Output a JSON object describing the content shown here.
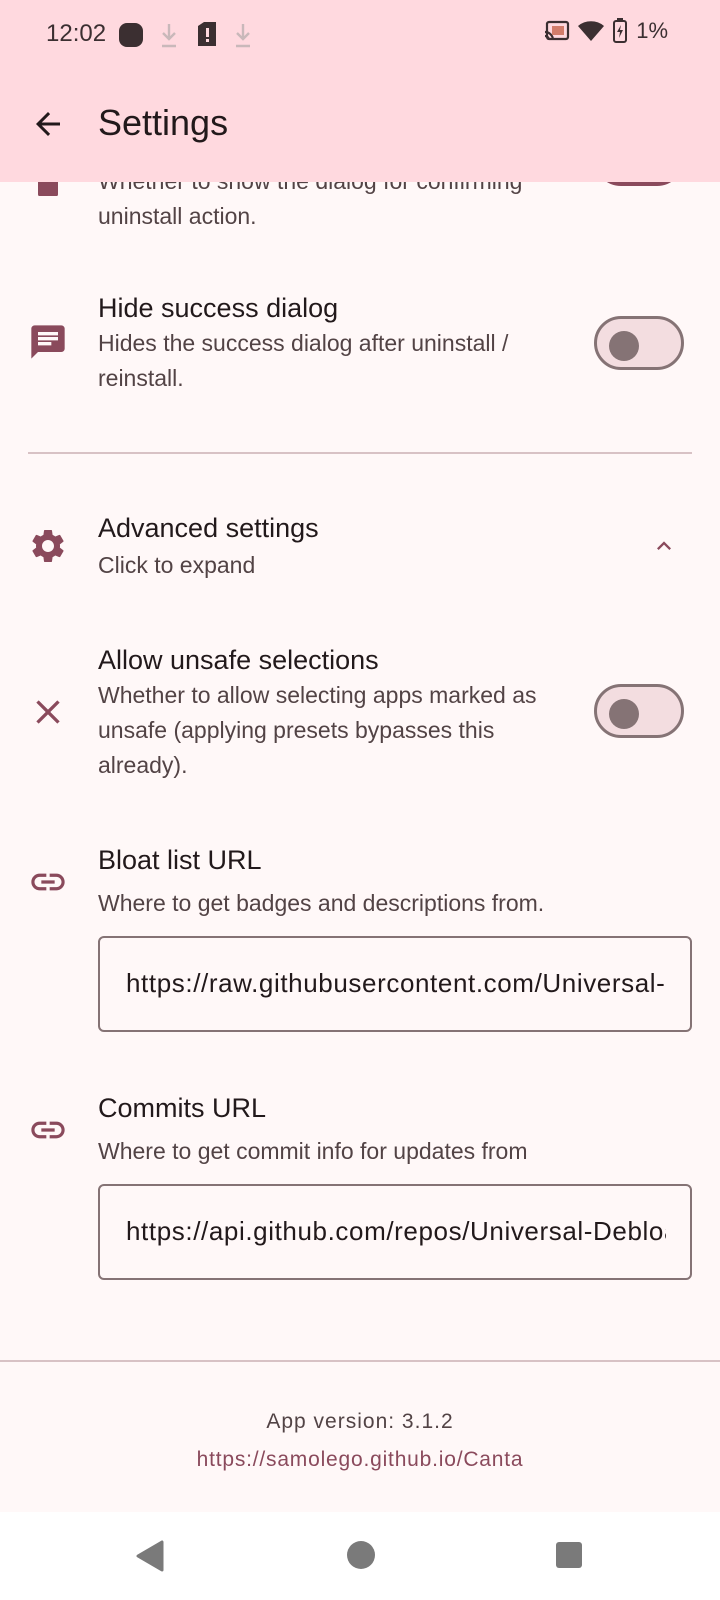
{
  "status_bar": {
    "time": "12:02",
    "battery": "1%"
  },
  "app_bar": {
    "title": "Settings",
    "back_icon": "arrow-back-icon"
  },
  "settings": {
    "confirm_uninstall": {
      "subtitle_line1": "Whether to show the dialog for confirming",
      "subtitle_line2": "uninstall action.",
      "enabled": true
    },
    "hide_success": {
      "title": "Hide success dialog",
      "subtitle_line1": "Hides the success dialog after uninstall /",
      "subtitle_line2": "reinstall.",
      "icon": "message-icon",
      "enabled": false
    },
    "advanced": {
      "title": "Advanced settings",
      "subtitle": "Click to expand",
      "icon": "gear-icon"
    },
    "allow_unsafe": {
      "title": "Allow unsafe selections",
      "subtitle_line1": "Whether to allow selecting apps marked as",
      "subtitle_line2": "unsafe (applying presets bypasses this",
      "subtitle_line3": "already).",
      "icon": "close-icon",
      "enabled": false
    },
    "bloat_list": {
      "title": "Bloat list URL",
      "subtitle": "Where to get badges and descriptions from.",
      "value": "https://raw.githubusercontent.com/Universal-Debloater-Alliance/universal-android-debloater-next-generation/main/resources/assets/uad_lists.json",
      "icon": "link-icon"
    },
    "commits": {
      "title": "Commits URL",
      "subtitle": "Where to get commit info for updates from",
      "value": "https://api.github.com/repos/Universal-Debloater-Alliance/universal-android-debloater-next-generation/commits",
      "icon": "link-icon"
    }
  },
  "footer": {
    "version": "App version: 3.1.2",
    "link": "https://samolego.github.io/Canta"
  },
  "colors": {
    "accent": "#8a4a5c",
    "bar_bg": "#ffd9df",
    "page_bg": "#fff8f8"
  }
}
